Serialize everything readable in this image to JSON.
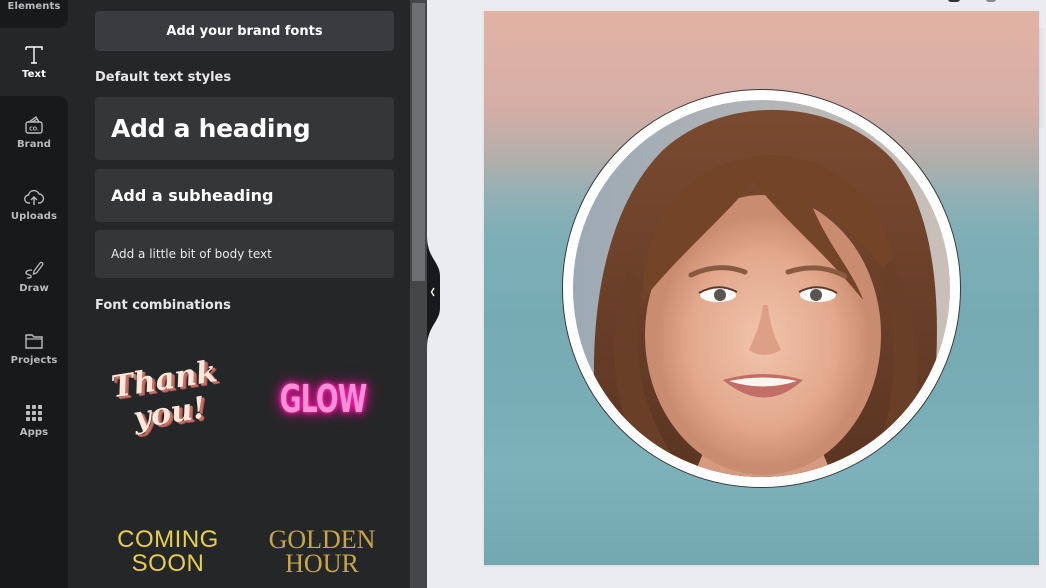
{
  "sidebar": {
    "items": [
      {
        "id": "elements",
        "label": "Elements",
        "icon": "elements-icon"
      },
      {
        "id": "text",
        "label": "Text",
        "icon": "text-icon",
        "active": true
      },
      {
        "id": "brand",
        "label": "Brand",
        "icon": "brand-icon"
      },
      {
        "id": "uploads",
        "label": "Uploads",
        "icon": "cloud-upload-icon"
      },
      {
        "id": "draw",
        "label": "Draw",
        "icon": "pen-icon"
      },
      {
        "id": "projects",
        "label": "Projects",
        "icon": "folder-icon"
      },
      {
        "id": "apps",
        "label": "Apps",
        "icon": "apps-grid-icon"
      }
    ]
  },
  "text_panel": {
    "brand_fonts_button": "Add your brand fonts",
    "default_styles_title": "Default text styles",
    "styles": {
      "heading": "Add a heading",
      "subheading": "Add a subheading",
      "body": "Add a little bit of body text"
    },
    "font_combinations_title": "Font combinations",
    "combinations": {
      "thank_you": {
        "line1": "Thank",
        "line2": "you!"
      },
      "glow": {
        "line1": "GLOW"
      },
      "coming_soon": {
        "line1": "COMING",
        "line2": "SOON"
      },
      "golden_hour": {
        "line1": "GOLDEN",
        "line2": "HOUR"
      }
    }
  },
  "canvas": {
    "element": "circular photo frame",
    "photo_alt": "portrait of smiling woman with brown hair"
  },
  "colors": {
    "rail_bg": "#18191b",
    "panel_bg": "#252627",
    "card_bg": "#353638",
    "workspace_bg": "#ebecf0",
    "glow_pink": "#ff8fd8",
    "coming_gold": "#e5cf4c",
    "golden_gold": "#c9a54a"
  }
}
